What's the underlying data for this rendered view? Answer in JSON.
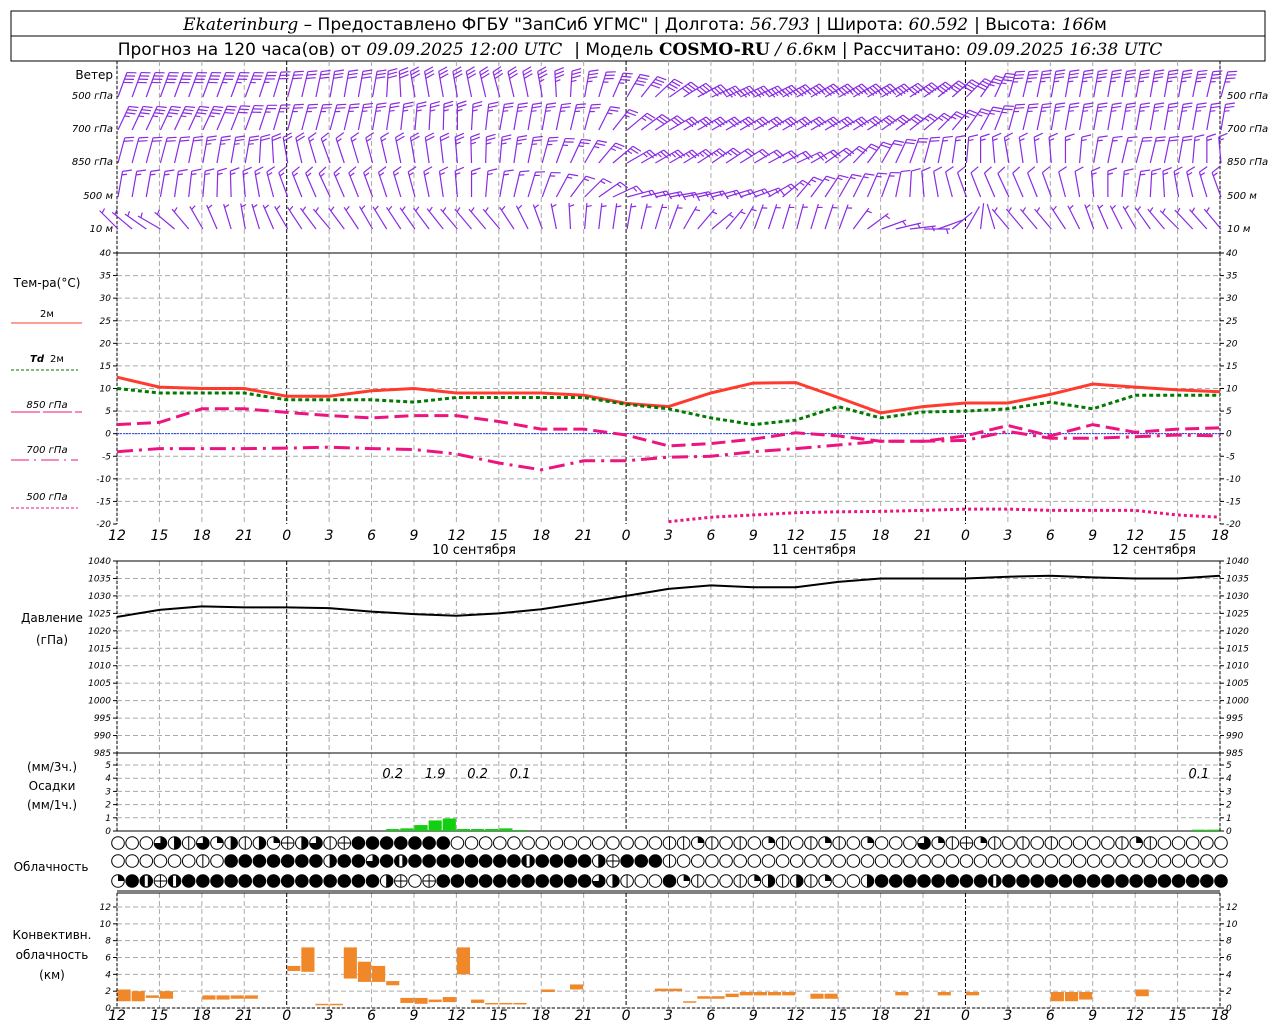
{
  "header": {
    "city": "Ekaterinburg",
    "provider": " – Предоставлено ФГБУ \"ЗапСиб УГМС\" ",
    "sep": "|",
    "lon_label": " Долгота: ",
    "lon": "56.793",
    "lat_label": " Широта: ",
    "lat": "60.592",
    "alt_label": " Высота: ",
    "alt": "166",
    "alt_unit": "м",
    "forecast_label": "Прогноз на 120 часа(ов) от ",
    "forecast_time": "09.09.2025 12:00 UTC",
    "model_label": " Модель ",
    "model": "COSMO-RU",
    "resolution": " / 6.6",
    "res_unit": "км ",
    "calc_label": " Рассчитано: ",
    "calc_time": "09.09.2025 16:38 UTC"
  },
  "labels": {
    "wind": "Ветер",
    "lvl_500": "500 гПа",
    "lvl_700": "700 гПа",
    "lvl_850": "850 гПа",
    "lvl_500m": "500 м",
    "lvl_10m": "10  м",
    "temp_title": "Тем-ра(°C)",
    "t2m": "2м",
    "td": "Td",
    "td_2m": "2м",
    "t850": "850 гПа",
    "t700": "700 гПа",
    "t500": "500 гПа",
    "pressure": "Давление",
    "pressure_unit": "(гПа)",
    "precip_3h": "(мм/3ч.)",
    "precip": "Осадки",
    "precip_1h": "(мм/1ч.)",
    "clouds": "Облачность",
    "conv1": "Конвективн.",
    "conv2": "облачность",
    "conv3": "(км)",
    "date1": "10 сентября",
    "date2": "11 сентября",
    "date3": "12 сентября"
  },
  "colors": {
    "wind": "#8a2be2",
    "t2m": "#ff3b30",
    "td": "#007a00",
    "upper": "#ee1480",
    "zero": "#2040ff",
    "precip": "#10d010",
    "conv": "#f0882a"
  },
  "chart_data": {
    "type": "meteogram",
    "x_hours_step": 3,
    "x_tick_labels": [
      "12",
      "15",
      "18",
      "21",
      "0",
      "3",
      "6",
      "9",
      "12",
      "15",
      "18",
      "21",
      "0",
      "3",
      "6",
      "9",
      "12",
      "15",
      "18",
      "21",
      "0",
      "3",
      "6",
      "9",
      "12",
      "15",
      "18"
    ],
    "temperature": {
      "ylim": [
        -20,
        40
      ],
      "ticks": [
        -20,
        -15,
        -10,
        -5,
        0,
        5,
        10,
        15,
        20,
        25,
        30,
        35,
        40
      ],
      "series": [
        {
          "name": "2м",
          "values": [
            12.5,
            10.3,
            10,
            10,
            8.3,
            8.3,
            9.5,
            10,
            9,
            9,
            9,
            8.5,
            6.7,
            6,
            9,
            11.2,
            11.3,
            8,
            4.6,
            6,
            6.8,
            6.8,
            8.7,
            11,
            10.3,
            9.7,
            9.3
          ]
        },
        {
          "name": "Td 2м",
          "values": [
            10,
            9,
            9,
            9,
            7.5,
            7.5,
            7.5,
            7,
            8,
            8,
            8,
            8,
            6.5,
            5.5,
            3.5,
            2,
            3,
            6,
            3.5,
            4.8,
            5,
            5.5,
            7,
            5.5,
            8.5,
            8.5,
            8.5
          ]
        },
        {
          "name": "850 гПа",
          "values": [
            2,
            2.5,
            5.5,
            5.5,
            4.7,
            4,
            3.5,
            4,
            4,
            2.7,
            1,
            1,
            -0.3,
            -2.7,
            -2.2,
            -1.2,
            0.2,
            -0.5,
            -1.7,
            -1.7,
            -0.5,
            1.8,
            -0.5,
            2,
            0.3,
            1,
            1.3
          ]
        },
        {
          "name": "700 гПа",
          "values": [
            -4,
            -3.3,
            -3.3,
            -3.3,
            -3.2,
            -3,
            -3.3,
            -3.5,
            -4.5,
            -6.5,
            -8,
            -6,
            -6,
            -5.2,
            -5,
            -4,
            -3.3,
            -2.5,
            -1.7,
            -1.7,
            -1.5,
            0.5,
            -1,
            -1,
            -0.7,
            -0.3,
            -0.5
          ]
        },
        {
          "name": "500 гПа",
          "values": [
            -20,
            -20.5,
            -21,
            -21,
            -20,
            -21,
            -21,
            -21,
            -21,
            -21,
            -21,
            -21,
            -21,
            -19.5,
            -18.5,
            -18,
            -17.5,
            -17.3,
            -17.2,
            -17,
            -16.7,
            -16.7,
            -17,
            -17,
            -17,
            -18,
            -18.5
          ]
        }
      ]
    },
    "pressure": {
      "ylim": [
        985,
        1040
      ],
      "ticks": [
        985,
        990,
        995,
        1000,
        1005,
        1010,
        1015,
        1020,
        1025,
        1030,
        1035,
        1040
      ],
      "values": [
        1024,
        1026,
        1027,
        1026.7,
        1026.7,
        1026.5,
        1025.5,
        1024.8,
        1024.3,
        1025,
        1026.2,
        1028,
        1030,
        1032,
        1033,
        1032.5,
        1032.5,
        1034,
        1035,
        1035,
        1035,
        1035.5,
        1035.8,
        1035.3,
        1035,
        1035,
        1035.8
      ]
    },
    "precipitation": {
      "ylim": [
        0,
        5
      ],
      "ticks": [
        0,
        1,
        2,
        3,
        4,
        5
      ],
      "hourly": [
        [
          19,
          0.15
        ],
        [
          20,
          0.2
        ],
        [
          21,
          0.45
        ],
        [
          22,
          0.8
        ],
        [
          23,
          0.95
        ],
        [
          24,
          0.15
        ],
        [
          25,
          0.15
        ],
        [
          26,
          0.15
        ],
        [
          27,
          0.2
        ],
        [
          28,
          0.08
        ],
        [
          76,
          0.1
        ],
        [
          77,
          0.1
        ]
      ],
      "three_hour_labels": [
        [
          19.5,
          "0.2"
        ],
        [
          22.5,
          "1.9"
        ],
        [
          25.5,
          "0.2"
        ],
        [
          28.5,
          "0.1"
        ],
        [
          76.5,
          "0.1"
        ]
      ]
    },
    "cloudiness": {
      "legend": "0 clear, 1 trace, 2 quarter, 4 half, 6 three-quarter, 7 nearly overcast, 8 overcast, 9 obscured",
      "high": "000641624142946198888888000000000000000",
      "high2": "1121010210121020006219210101000012100000",
      "mid": "00000010888888848868788888888788884988810",
      "mid2": "00000000000000000000000000000000000000",
      "low": "287978888888888888849098888888888864100",
      "low2": "8210012414120048888888878888888888888888"
    },
    "convective": {
      "ylim": [
        0,
        12
      ],
      "ticks": [
        0,
        2,
        4,
        6,
        8,
        10,
        12
      ],
      "bars": [
        [
          1,
          0.8,
          2.2
        ],
        [
          2,
          0.8,
          2.0
        ],
        [
          3,
          1.2,
          1.5
        ],
        [
          4,
          1.1,
          2.0
        ],
        [
          7,
          1.0,
          1.5
        ],
        [
          8,
          1.0,
          1.5
        ],
        [
          9,
          1.1,
          1.5
        ],
        [
          10,
          1.1,
          1.5
        ],
        [
          13,
          4.4,
          5.0
        ],
        [
          14,
          4.3,
          7.2
        ],
        [
          15,
          0.4,
          0.5
        ],
        [
          16,
          0.4,
          0.5
        ],
        [
          17,
          3.5,
          7.2
        ],
        [
          18,
          3.1,
          5.5
        ],
        [
          19,
          3.1,
          5.0
        ],
        [
          20,
          2.7,
          3.2
        ],
        [
          21,
          0.6,
          1.2
        ],
        [
          22,
          0.5,
          1.2
        ],
        [
          23,
          0.7,
          1.0
        ],
        [
          24,
          0.7,
          1.3
        ],
        [
          25,
          4.0,
          7.2
        ],
        [
          26,
          0.6,
          1.0
        ],
        [
          27,
          0.5,
          0.6
        ],
        [
          28,
          0.5,
          0.6
        ],
        [
          29,
          0.5,
          0.6
        ],
        [
          31,
          1.9,
          2.2
        ],
        [
          33,
          2.2,
          2.8
        ],
        [
          39,
          2.0,
          2.3
        ],
        [
          40,
          2.0,
          2.3
        ],
        [
          41,
          0.7,
          0.8
        ],
        [
          42,
          1.1,
          1.4
        ],
        [
          43,
          1.1,
          1.4
        ],
        [
          44,
          1.3,
          1.7
        ],
        [
          45,
          1.5,
          1.9
        ],
        [
          46,
          1.5,
          1.9
        ],
        [
          47,
          1.5,
          1.9
        ],
        [
          48,
          1.5,
          1.9
        ],
        [
          50,
          1.1,
          1.7
        ],
        [
          51,
          1.1,
          1.7
        ],
        [
          56,
          1.5,
          1.9
        ],
        [
          59,
          1.5,
          1.9
        ],
        [
          61,
          1.5,
          1.9
        ],
        [
          67,
          0.8,
          1.9
        ],
        [
          68,
          0.8,
          1.9
        ],
        [
          69,
          1.0,
          1.9
        ],
        [
          73,
          1.4,
          2.2
        ]
      ]
    },
    "wind": {
      "units": "m/s",
      "levels": [
        {
          "name": "500 гПа",
          "dir": [
            20,
            20,
            20,
            20,
            15,
            10,
            10,
            350,
            350,
            345,
            350,
            10,
            30,
            55,
            65,
            65,
            60,
            60,
            60,
            55,
            45,
            15,
            10,
            10,
            10,
            10,
            15
          ],
          "speed": [
            20,
            20,
            20,
            18,
            16,
            15,
            15,
            15,
            16,
            16,
            17,
            18,
            20,
            20,
            22,
            22,
            22,
            22,
            22,
            20,
            20,
            18,
            18,
            18,
            17,
            17,
            17
          ]
        },
        {
          "name": "700 гПа",
          "dir": [
            25,
            25,
            25,
            20,
            15,
            15,
            10,
            5,
            0,
            10,
            10,
            15,
            50,
            60,
            60,
            60,
            60,
            60,
            55,
            50,
            35,
            15,
            10,
            10,
            10,
            10,
            10
          ],
          "speed": [
            18,
            18,
            17,
            15,
            13,
            12,
            12,
            12,
            12,
            13,
            14,
            14,
            14,
            16,
            16,
            16,
            16,
            15,
            15,
            14,
            14,
            14,
            13,
            12,
            12,
            12,
            12
          ]
        },
        {
          "name": "850 гПа",
          "dir": [
            15,
            15,
            10,
            10,
            350,
            340,
            345,
            350,
            355,
            5,
            15,
            30,
            60,
            60,
            55,
            60,
            65,
            50,
            30,
            15,
            5,
            350,
            355,
            10,
            15,
            10,
            355
          ],
          "speed": [
            10,
            10,
            12,
            12,
            10,
            9,
            9,
            10,
            12,
            12,
            12,
            12,
            12,
            12,
            12,
            10,
            10,
            10,
            10,
            10,
            8,
            8,
            8,
            8,
            10,
            10,
            8
          ]
        },
        {
          "name": "500 м",
          "dir": [
            10,
            10,
            5,
            355,
            340,
            335,
            340,
            345,
            355,
            10,
            20,
            45,
            75,
            80,
            75,
            70,
            40,
            30,
            20,
            355,
            340,
            335,
            340,
            355,
            10,
            350,
            340
          ],
          "speed": [
            8,
            9,
            9,
            9,
            8,
            7,
            7,
            7,
            8,
            8,
            8,
            9,
            9,
            8,
            8,
            8,
            8,
            8,
            7,
            6,
            6,
            6,
            6,
            7,
            8,
            8,
            7
          ]
        },
        {
          "name": "10 м",
          "dir": [
            315,
            300,
            330,
            350,
            330,
            320,
            330,
            325,
            320,
            320,
            340,
            5,
            10,
            20,
            50,
            20,
            15,
            20,
            70,
            90,
            30,
            320,
            320,
            340,
            330,
            315,
            320
          ],
          "speed": [
            3,
            3,
            3,
            3,
            3,
            3,
            3,
            3,
            3,
            3,
            3,
            3,
            3,
            3,
            3,
            3,
            3,
            2,
            2,
            2,
            1,
            2,
            3,
            3,
            3,
            3,
            3
          ]
        }
      ]
    }
  }
}
